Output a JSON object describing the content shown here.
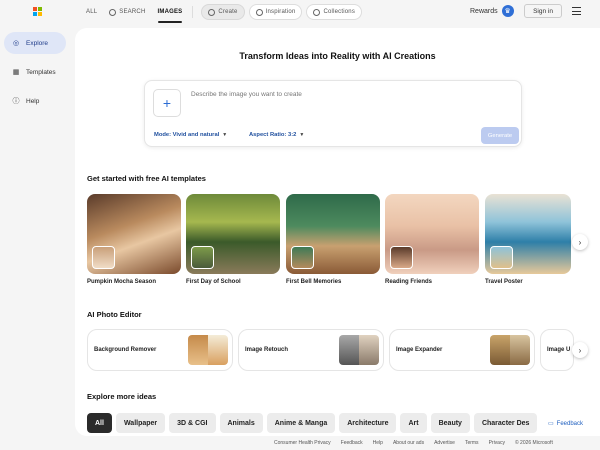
{
  "topbar": {
    "nav": [
      {
        "label": "ALL",
        "icon": ""
      },
      {
        "label": "SEARCH",
        "icon": "search-icon"
      },
      {
        "label": "IMAGES",
        "icon": ""
      },
      {
        "label": "Create",
        "icon": "create-icon"
      },
      {
        "label": "Inspiration",
        "icon": "inspiration-icon"
      },
      {
        "label": "Collections",
        "icon": "collections-icon"
      }
    ],
    "rewards_label": "Rewards",
    "signin_label": "Sign in"
  },
  "sidebar": {
    "items": [
      {
        "label": "Explore",
        "icon": "explore-icon"
      },
      {
        "label": "Templates",
        "icon": "templates-icon"
      },
      {
        "label": "Help",
        "icon": "help-icon"
      }
    ]
  },
  "hero": {
    "title": "Transform Ideas into Reality with AI Creations",
    "prompt_placeholder": "Describe the image you want to create",
    "mode_label": "Mode: Vivid and natural",
    "aspect_label": "Aspect Ratio: 3:2",
    "generate_label": "Generate"
  },
  "templates": {
    "title": "Get started with free AI templates",
    "items": [
      {
        "label": "Pumpkin Mocha Season"
      },
      {
        "label": "First Day of School"
      },
      {
        "label": "First Bell Memories"
      },
      {
        "label": "Reading Friends"
      },
      {
        "label": "Travel Poster"
      }
    ]
  },
  "editor": {
    "title": "AI Photo Editor",
    "items": [
      {
        "label": "Background Remover"
      },
      {
        "label": "Image Retouch"
      },
      {
        "label": "Image Expander"
      },
      {
        "label": "Image U"
      }
    ]
  },
  "explore": {
    "title": "Explore more ideas",
    "chips": [
      "All",
      "Wallpaper",
      "3D & CGI",
      "Animals",
      "Anime & Manga",
      "Architecture",
      "Art",
      "Beauty",
      "Character Des"
    ]
  },
  "footer": {
    "links": [
      "Consumer Health Privacy",
      "Feedback",
      "Help",
      "About our ads",
      "Advertise",
      "Terms",
      "Privacy",
      "© 2026 Microsoft"
    ],
    "feedback_label": "Feedback"
  },
  "colors": {
    "accent": "#2b6cd3",
    "sidebar_active": "#dfe6f7",
    "generate_disabled": "#bccbf0"
  }
}
